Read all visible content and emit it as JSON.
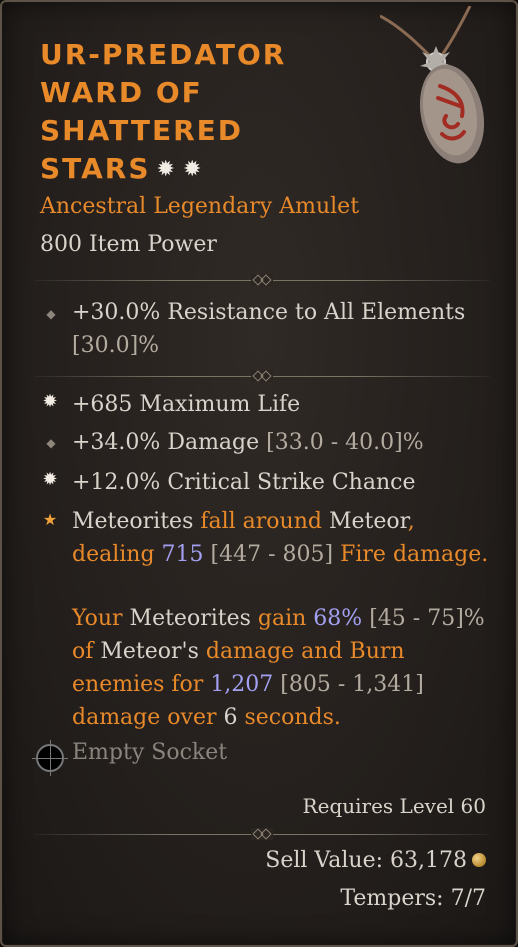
{
  "item": {
    "title_lines": [
      "UR-PREDATOR",
      "WARD OF",
      "SHATTERED",
      "STARS"
    ],
    "title_glyphs": [
      "✹",
      "✹"
    ],
    "type": "Ancestral Legendary Amulet",
    "power": "800 Item Power"
  },
  "implicit": {
    "line1": "+30.0% Resistance to All Elements",
    "line2": "[30.0]%"
  },
  "affixes": [
    {
      "icon": "greater-affix-icon",
      "text": "+685 Maximum Life"
    },
    {
      "icon": "diamond-bullet-icon",
      "text": "+34.0% Damage [33.0 - 40.0]%"
    },
    {
      "icon": "greater-affix-icon",
      "text": "+12.0% Critical Strike Chance"
    }
  ],
  "aspect": {
    "icon": "legendary-star-icon",
    "p1": {
      "t1": "Meteorites",
      "t2": " fall around ",
      "t3": "Meteor",
      "t4": ",",
      "t5": "dealing ",
      "t6": "715",
      "t7": " [447 - 805] ",
      "t8": "Fire damage."
    },
    "p2": {
      "t1": "Your ",
      "t2": "Meteorites",
      "t3": " gain ",
      "t4": "68%",
      "t5": " [45 - 75]%",
      "t6": "of ",
      "t7": "Meteor's",
      "t8": " damage and Burn",
      "t9": "enemies for ",
      "t10": "1,207",
      "t11": " [805 - 1,341]",
      "t12": "damage over ",
      "t13": "6",
      "t14": " seconds."
    }
  },
  "socket": {
    "label": "Empty Socket"
  },
  "footer": {
    "requires": "Requires Level 60",
    "sell_value": "Sell Value: 63,178",
    "tempers": "Tempers: 7/7"
  },
  "colors": {
    "legendary": "#e8892a",
    "value": "#a3a0f2",
    "range": "#b3ab9f",
    "text": "#d9d3cb"
  }
}
